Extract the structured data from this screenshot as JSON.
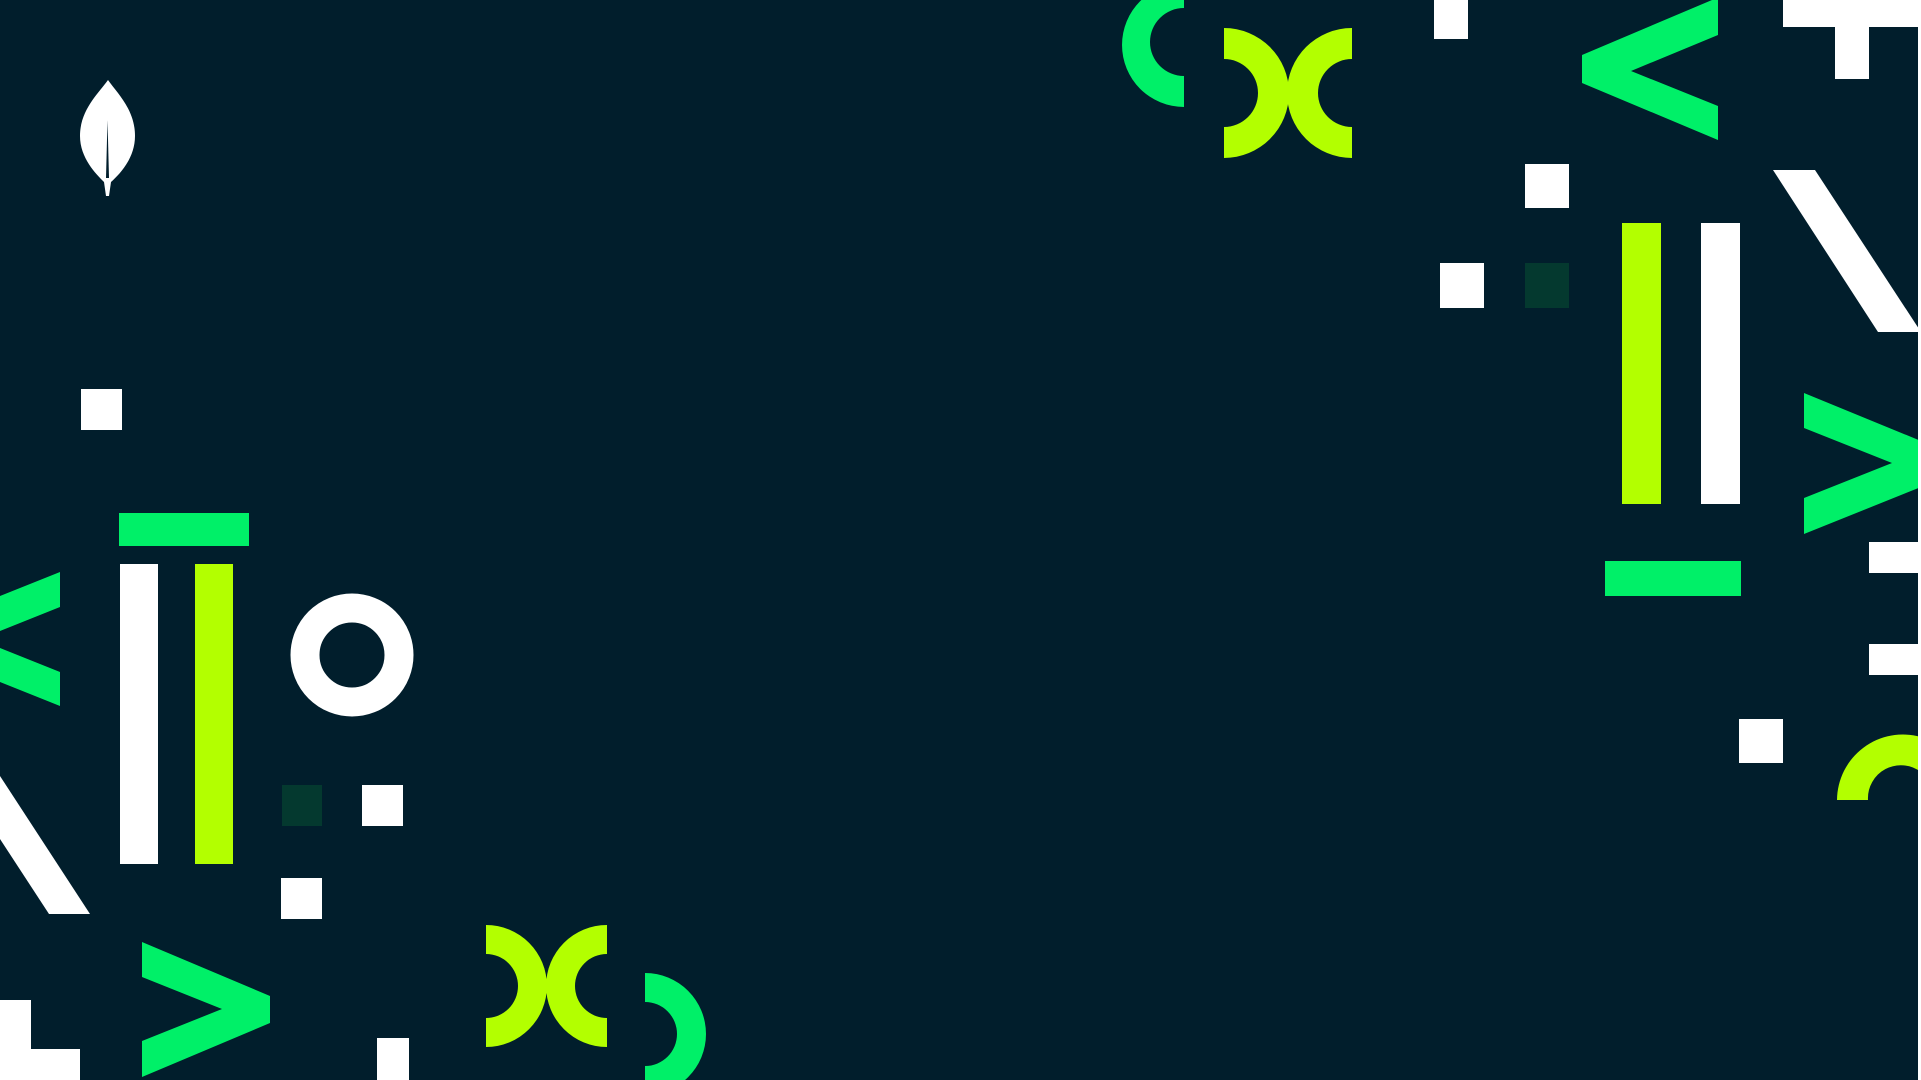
{
  "background_color": "#011E2C",
  "palette": {
    "green": "#00F068",
    "lime": "#B3FF00",
    "white": "#FFFFFF",
    "dark_green": "#04392F"
  },
  "logo": {
    "icon": "leaf-icon",
    "color": "#FFFFFF"
  },
  "decorations": {
    "shapes": [
      "square",
      "bar",
      "ring",
      "half-ring",
      "chevron",
      "diagonal-stroke",
      "corner-bracket"
    ]
  }
}
